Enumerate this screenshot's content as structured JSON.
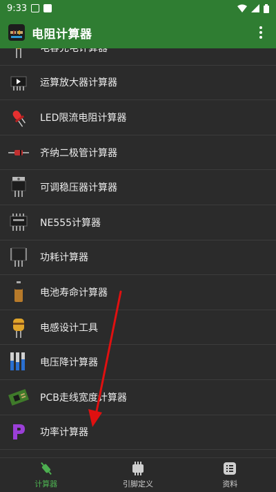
{
  "status_bar": {
    "time": "9:33"
  },
  "app_bar": {
    "title": "电阻计算器"
  },
  "list_items": [
    {
      "label": "电容充电计算器",
      "icon": "capacitor-icon"
    },
    {
      "label": "运算放大器计算器",
      "icon": "op-amp-chip-icon"
    },
    {
      "label": "LED限流电阻计算器",
      "icon": "led-icon"
    },
    {
      "label": "齐纳二极管计算器",
      "icon": "zener-diode-icon"
    },
    {
      "label": "可调稳压器计算器",
      "icon": "voltage-regulator-icon"
    },
    {
      "label": "NE555计算器",
      "icon": "ne555-chip-icon"
    },
    {
      "label": "功耗计算器",
      "icon": "transistor-icon"
    },
    {
      "label": "电池寿命计算器",
      "icon": "battery-icon"
    },
    {
      "label": "电感设计工具",
      "icon": "inductor-icon"
    },
    {
      "label": "电压降计算器",
      "icon": "wire-cable-icon"
    },
    {
      "label": "PCB走线宽度计算器",
      "icon": "pcb-icon"
    },
    {
      "label": "功率计算器",
      "icon": "power-p-icon"
    }
  ],
  "bottom_nav": [
    {
      "label": "计算器",
      "icon": "calculator-tab-icon",
      "active": true
    },
    {
      "label": "引脚定义",
      "icon": "pinout-tab-icon",
      "active": false
    },
    {
      "label": "资料",
      "icon": "reference-tab-icon",
      "active": false
    }
  ],
  "colors": {
    "app_bar": "#2f7d32",
    "background": "#2b2b2b",
    "active_tab": "#4caf50",
    "annotation_arrow": "#e01010"
  }
}
